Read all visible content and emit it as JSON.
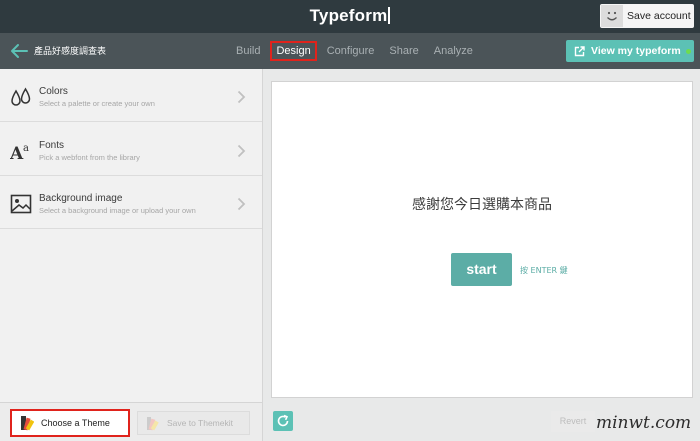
{
  "header": {
    "brand": "Typeform",
    "save_account_label": "Save account"
  },
  "nav": {
    "form_title": "產品好感度調查表",
    "tabs": [
      {
        "label": "Build"
      },
      {
        "label": "Design",
        "active": true
      },
      {
        "label": "Configure"
      },
      {
        "label": "Share"
      },
      {
        "label": "Analyze"
      }
    ],
    "view_button_label": "View my typeform",
    "status_color": "#6fdc4e"
  },
  "sidebar": {
    "items": [
      {
        "title": "Colors",
        "desc": "Select a palette or create your own",
        "icon": "drops-icon"
      },
      {
        "title": "Fonts",
        "desc": "Pick a webfont from the library",
        "icon": "font-icon"
      },
      {
        "title": "Background image",
        "desc": "Select a background image or upload your own",
        "icon": "image-icon"
      }
    ],
    "choose_theme_label": "Choose a Theme",
    "save_themekit_label": "Save to Themekit"
  },
  "preview": {
    "message": "感謝您今日選購本商品",
    "start_label": "start",
    "enter_hint": "按 ENTER 鍵",
    "accent_color": "#5cada6"
  },
  "footer": {
    "revert_label": "Revert",
    "watermark": "minwt.com"
  },
  "colors": {
    "topbar": "#2f3a3f",
    "navbar": "#4b5458",
    "accent": "#5cc1b5",
    "highlight": "#e0231c"
  }
}
